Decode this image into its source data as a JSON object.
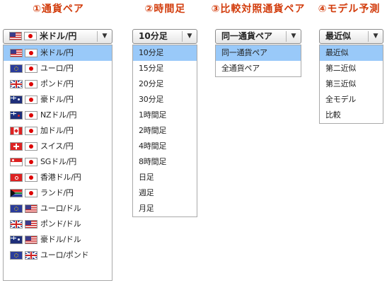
{
  "arrow_glyph": "▼",
  "columns": [
    {
      "heading": "①通貨ペア",
      "combo": {
        "selected": "米ドル/円",
        "flags": [
          "flag-us",
          "flag-jp"
        ]
      },
      "items": [
        {
          "label": "米ドル/円",
          "flags": [
            "flag-us",
            "flag-jp"
          ],
          "selected": true
        },
        {
          "label": "ユーロ/円",
          "flags": [
            "flag-eu",
            "flag-jp"
          ]
        },
        {
          "label": "ポンド/円",
          "flags": [
            "flag-gb",
            "flag-jp"
          ]
        },
        {
          "label": "豪ドル/円",
          "flags": [
            "flag-au",
            "flag-jp"
          ]
        },
        {
          "label": "NZドル/円",
          "flags": [
            "flag-nz",
            "flag-jp"
          ]
        },
        {
          "label": "加ドル/円",
          "flags": [
            "flag-ca",
            "flag-jp"
          ]
        },
        {
          "label": "スイス/円",
          "flags": [
            "flag-ch",
            "flag-jp"
          ]
        },
        {
          "label": "SGドル/円",
          "flags": [
            "flag-sg",
            "flag-jp"
          ]
        },
        {
          "label": "香港ドル/円",
          "flags": [
            "flag-hk",
            "flag-jp"
          ]
        },
        {
          "label": "ランド/円",
          "flags": [
            "flag-za",
            "flag-jp"
          ]
        },
        {
          "label": "ユーロ/ドル",
          "flags": [
            "flag-eu",
            "flag-us"
          ]
        },
        {
          "label": "ポンド/ドル",
          "flags": [
            "flag-gb",
            "flag-us"
          ]
        },
        {
          "label": "豪ドル/ドル",
          "flags": [
            "flag-au",
            "flag-us"
          ]
        },
        {
          "label": "ユーロ/ポンド",
          "flags": [
            "flag-eu",
            "flag-gb"
          ]
        }
      ]
    },
    {
      "heading": "②時間足",
      "combo": {
        "selected": "10分足"
      },
      "items": [
        {
          "label": "10分足",
          "selected": true
        },
        {
          "label": "15分足"
        },
        {
          "label": "20分足"
        },
        {
          "label": "30分足"
        },
        {
          "label": "1時間足"
        },
        {
          "label": "2時間足"
        },
        {
          "label": "4時間足"
        },
        {
          "label": "8時間足"
        },
        {
          "label": "日足"
        },
        {
          "label": "週足"
        },
        {
          "label": "月足"
        }
      ]
    },
    {
      "heading": "③比較対照通貨ペア",
      "combo": {
        "selected": "同一通貨ペア"
      },
      "items": [
        {
          "label": "同一通貨ペア",
          "selected": true
        },
        {
          "label": "全通貨ペア"
        }
      ]
    },
    {
      "heading": "④モデル予測",
      "combo": {
        "selected": "最近似"
      },
      "items": [
        {
          "label": "最近似",
          "selected": true
        },
        {
          "label": "第二近似"
        },
        {
          "label": "第三近似"
        },
        {
          "label": "全モデル"
        },
        {
          "label": "比較"
        }
      ]
    }
  ]
}
